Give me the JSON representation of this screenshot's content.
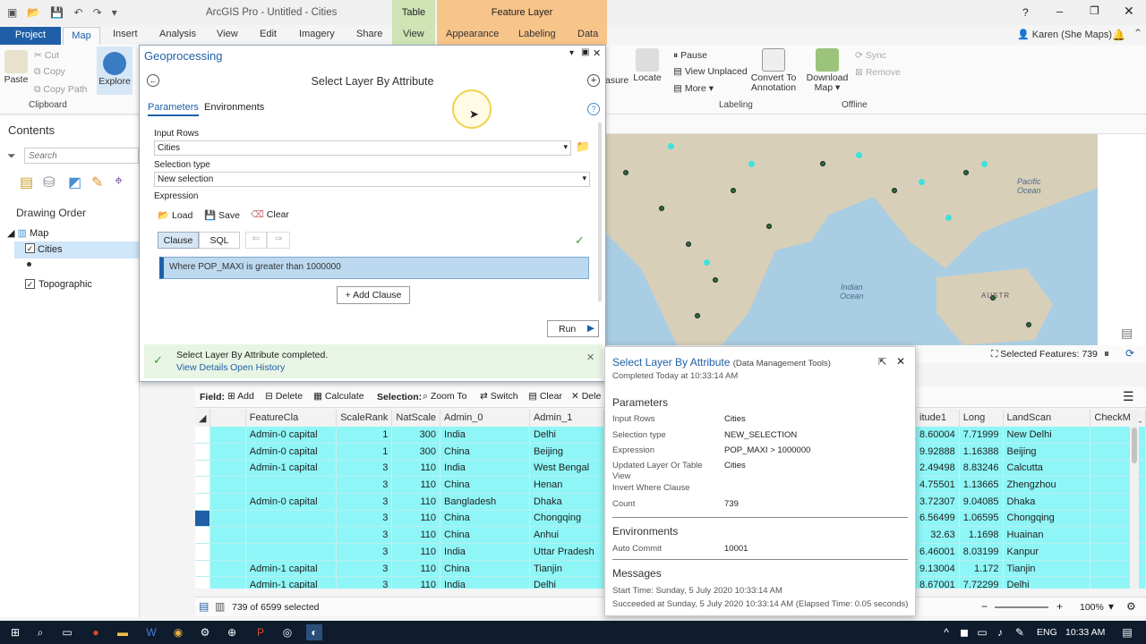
{
  "titlebar": {
    "title": "ArcGIS Pro - Untitled - Cities",
    "help": "?",
    "ctx_table": "Table",
    "ctx_feature_layer": "Feature Layer"
  },
  "ribbon_tabs": [
    "Project",
    "Map",
    "Insert",
    "Analysis",
    "View",
    "Edit",
    "Imagery",
    "Share",
    "View",
    "Appearance",
    "Labeling",
    "Data"
  ],
  "user": "Karen (She Maps)",
  "clipboard": {
    "cut": "Cut",
    "copy": "Copy",
    "paste": "Paste",
    "copy_path": "Copy Path",
    "group": "Clipboard"
  },
  "explore": "Explore",
  "labeling": {
    "pause": "Pause",
    "view_unplaced": "View Unplaced",
    "more": "More",
    "measure": "asure",
    "locate": "Locate",
    "convert": "Convert To",
    "annotation": "Annotation",
    "group": "Labeling"
  },
  "offline": {
    "download": "Download",
    "map": "Map",
    "sync": "Sync",
    "remove": "Remove",
    "group": "Offline"
  },
  "contents": {
    "title": "Contents",
    "search_placeholder": "Search",
    "drawing_order": "Drawing Order",
    "map": "Map",
    "cities": "Cities",
    "topographic": "Topographic"
  },
  "map": {
    "pacific": "Pacific",
    "pacific2": "Ocean",
    "indian": "Indian",
    "indian2": "Ocean",
    "aust": "AUSTR",
    "selected": "Selected Features: 739"
  },
  "gp": {
    "title": "Geoprocessing",
    "tool": "Select Layer By Attribute",
    "tabs": [
      "Parameters",
      "Environments"
    ],
    "input_rows_label": "Input Rows",
    "input_rows": "Cities",
    "selection_type_label": "Selection type",
    "selection_type": "New selection",
    "expression_label": "Expression",
    "load": "Load",
    "save": "Save",
    "clear": "Clear",
    "clause": "Clause",
    "sql": "SQL",
    "where": "Where POP_MAXI is greater than 1000000",
    "add_clause": "Add Clause",
    "run": "Run",
    "done_msg": "Select Layer By Attribute completed.",
    "view_details": "View Details",
    "open_history": "Open History"
  },
  "table_toolbar": {
    "field": "Field:",
    "add": "Add",
    "delete": "Delete",
    "calculate": "Calculate",
    "selection": "Selection:",
    "zoom_to": "Zoom To",
    "switch": "Switch",
    "clear": "Clear",
    "dele": "Dele"
  },
  "table": {
    "headers": [
      "FeatureCla",
      "ScaleRank",
      "NatScale",
      "Admin_0",
      "Admin_1"
    ],
    "rows": [
      [
        "Admin-0 capital",
        "1",
        "300",
        "India",
        "Delhi"
      ],
      [
        "Admin-0 capital",
        "1",
        "300",
        "China",
        "Beijing"
      ],
      [
        "Admin-1 capital",
        "3",
        "110",
        "India",
        "West Bengal"
      ],
      [
        "",
        "3",
        "110",
        "China",
        "Henan"
      ],
      [
        "Admin-0 capital",
        "3",
        "110",
        "Bangladesh",
        "Dhaka"
      ],
      [
        "",
        "3",
        "110",
        "China",
        "Chongqing"
      ],
      [
        "",
        "3",
        "110",
        "China",
        "Anhui"
      ],
      [
        "",
        "3",
        "110",
        "India",
        "Uttar Pradesh"
      ],
      [
        "Admin-1 capital",
        "3",
        "110",
        "China",
        "Tianjin"
      ],
      [
        "Admin-1 capital",
        "3",
        "110",
        "India",
        "Delhi"
      ]
    ],
    "right_headers": [
      "itude1",
      "Long",
      "LandScan",
      "CheckMe_"
    ],
    "right_rows": [
      [
        "8.60004",
        "7.71999",
        "New Delhi"
      ],
      [
        "9.92888",
        "1.16388",
        "Beijing"
      ],
      [
        "2.49498",
        "8.83246",
        "Calcutta"
      ],
      [
        "4.75501",
        "1.13665",
        "Zhengzhou"
      ],
      [
        "3.72307",
        "9.04085",
        "Dhaka"
      ],
      [
        "6.56499",
        "1.06595",
        "Chongqing"
      ],
      [
        "32.63",
        "1.1698",
        "Huainan"
      ],
      [
        "6.46001",
        "8.03199",
        "Kanpur"
      ],
      [
        "9.13004",
        "1.172",
        "Tianjin"
      ],
      [
        "8.67001",
        "7.72299",
        "Delhi"
      ]
    ],
    "status": "739 of 6599 selected"
  },
  "history": {
    "title": "Select Layer By Attribute",
    "subtitle": "(Data Management Tools)",
    "completed": "Completed Today at 10:33:14 AM",
    "parameters": "Parameters",
    "params": [
      [
        "Input Rows",
        "Cities"
      ],
      [
        "Selection type",
        "NEW_SELECTION"
      ],
      [
        "Expression",
        "POP_MAXI > 1000000"
      ],
      [
        "Updated Layer Or Table",
        "Cities"
      ],
      [
        "View",
        ""
      ],
      [
        "Invert Where Clause",
        ""
      ],
      [
        "Count",
        "739"
      ]
    ],
    "environments": "Environments",
    "auto_commit": "Auto Commit",
    "auto_commit_val": "10001",
    "messages": "Messages",
    "msg1": "Start Time: Sunday, 5 July 2020 10:33:14 AM",
    "msg2": "Succeeded at Sunday, 5 July 2020 10:33:14 AM (Elapsed Time: 0.05 seconds)"
  },
  "statusbar": {
    "zoom": "100%"
  },
  "taskbar": {
    "lang": "ENG",
    "time": "10:33 AM"
  },
  "colors": {
    "accent": "#1f5fa8",
    "selected_row": "#8ff6f7",
    "ctx_table": "#cfe3b5",
    "ctx_feature": "#f7c48a"
  }
}
